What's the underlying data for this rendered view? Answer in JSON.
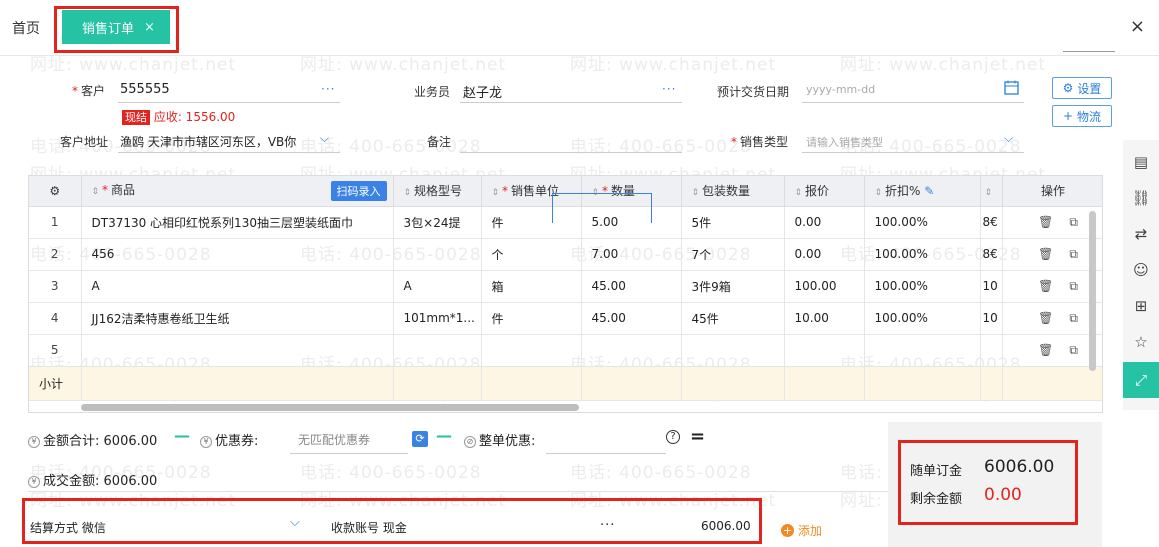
{
  "tabs": {
    "home": "首页",
    "active": "销售订单",
    "active_close": "×"
  },
  "window": {
    "close": "×"
  },
  "form": {
    "customer_label": "客户",
    "customer_value": "555555",
    "customer_more": "···",
    "cash_badge": "现结",
    "receivable": "应收: 1556.00",
    "salesman_label": "业务员",
    "salesman_value": "赵子龙",
    "salesman_more": "···",
    "delivery_label": "预计交货日期",
    "delivery_placeholder": "yyyy-mm-dd",
    "address_label": "客户地址",
    "address_value": "渔鸥 天津市市辖区河东区，VB你",
    "remark_label": "备注",
    "sales_type_label": "销售类型",
    "sales_type_placeholder": "请输入销售类型",
    "btn_settings": "设置",
    "btn_logistics": "物流"
  },
  "grid": {
    "headers": {
      "product": "商品",
      "scan": "扫码录入",
      "spec": "规格型号",
      "unit": "销售单位",
      "qty": "数量",
      "pack_qty": "包装数量",
      "price": "报价",
      "discount": "折扣%",
      "ops": "操作"
    },
    "rows": [
      {
        "no": "1",
        "product": "DT37130 心相印红悦系列130抽三层塑装纸面巾",
        "spec": "3包×24提",
        "unit": "件",
        "qty": "5.00",
        "pack": "5件",
        "price": "0.00",
        "discount": "100.00%",
        "extra": "8€"
      },
      {
        "no": "2",
        "product": "456",
        "spec": "",
        "unit": "个",
        "qty": "7.00",
        "pack": "7个",
        "price": "0.00",
        "discount": "100.00%",
        "extra": "8€"
      },
      {
        "no": "3",
        "product": "A",
        "spec": "A",
        "unit": "箱",
        "qty": "45.00",
        "pack": "3件9箱",
        "price": "100.00",
        "discount": "100.00%",
        "extra": "10"
      },
      {
        "no": "4",
        "product": "JJ162洁柔特惠卷纸卫生纸",
        "spec": "101mm*1...",
        "unit": "件",
        "qty": "45.00",
        "pack": "45件",
        "price": "10.00",
        "discount": "100.00%",
        "extra": "10"
      },
      {
        "no": "5",
        "product": "",
        "spec": "",
        "unit": "",
        "qty": "",
        "pack": "",
        "price": "",
        "discount": "",
        "extra": ""
      }
    ],
    "subtotal_label": "小计"
  },
  "summary": {
    "total_label": "金额合计:",
    "total_value": "6006.00",
    "coupon_label": "优惠券:",
    "coupon_value": "无匹配优惠券",
    "whole_discount_label": "整单优惠:",
    "deal_label": "成交金额:",
    "deal_value": "6006.00",
    "equals": "=",
    "help": "?"
  },
  "payment": {
    "method_label": "结算方式",
    "method_value": "微信",
    "account_label": "收款账号",
    "account_value": "现金",
    "account_more": "···",
    "amount": "6006.00",
    "add": "添加"
  },
  "right_panel": {
    "with_order_label": "随单订金",
    "with_order_value": "6006.00",
    "remaining_label": "剩余金额",
    "remaining_value": "0.00"
  },
  "watermark": {
    "phone": "电话: 400-665-0028",
    "site": "网址: www.chanjet.net"
  },
  "colors": {
    "accent": "#26c2a4",
    "highlight": "#e3231e",
    "link": "#2a7fe0"
  }
}
